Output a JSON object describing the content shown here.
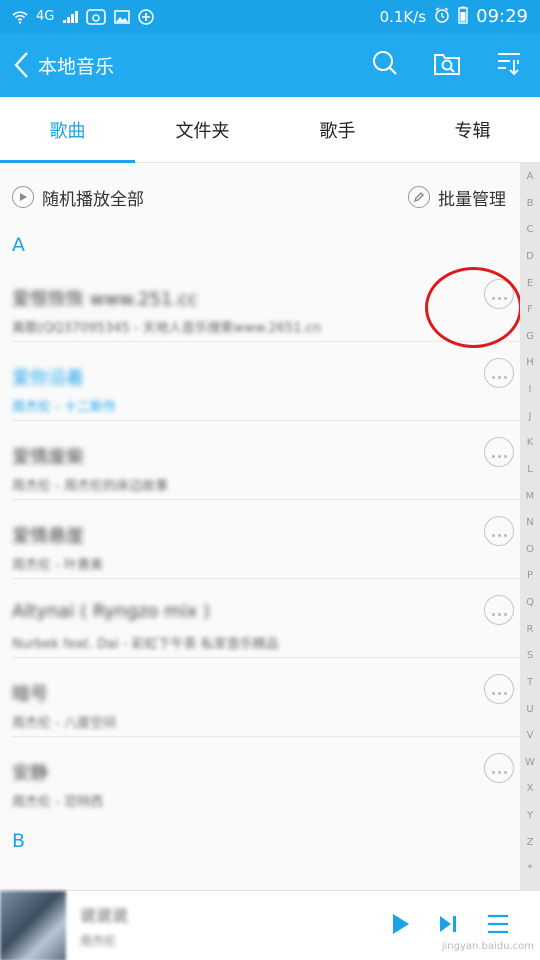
{
  "status": {
    "network_speed": "0.1K/s",
    "time": "09:29",
    "signal_label": "4G"
  },
  "appbar": {
    "title": "本地音乐"
  },
  "tabs": [
    {
      "label": "歌曲",
      "active": true
    },
    {
      "label": "文件夹",
      "active": false
    },
    {
      "label": "歌手",
      "active": false
    },
    {
      "label": "专辑",
      "active": false
    }
  ],
  "actions": {
    "shuffle_all": "随机播放全部",
    "batch_manage": "批量管理"
  },
  "sections": {
    "a": "A",
    "b": "B"
  },
  "songs": [
    {
      "title": "爱恨恢恢 www.251.cc",
      "subtitle": "离歌(QQ37095345 - 天地人音乐搜索www.2651.cn",
      "playing": false
    },
    {
      "title": "爱你沿着",
      "subtitle": "周杰伦 - 十二新作",
      "playing": true
    },
    {
      "title": "爱情废柴",
      "subtitle": "周杰伦 - 周杰伦的床边故事",
      "playing": false
    },
    {
      "title": "爱情悬崖",
      "subtitle": "周杰伦 - 叶惠美",
      "playing": false
    },
    {
      "title": "Altynai ( Ryngzo mix )",
      "subtitle": "Nurbek feat. Dai - 彩虹下午茶 私家音乐精品",
      "playing": false
    },
    {
      "title": "暗号",
      "subtitle": "周杰伦 - 八度空间",
      "playing": false
    },
    {
      "title": "安静",
      "subtitle": "周杰伦 - 范特西",
      "playing": false
    }
  ],
  "index_letters": [
    "A",
    "B",
    "C",
    "D",
    "E",
    "F",
    "G",
    "H",
    "I",
    "J",
    "K",
    "L",
    "M",
    "N",
    "O",
    "P",
    "Q",
    "R",
    "S",
    "T",
    "U",
    "V",
    "W",
    "X",
    "Y",
    "Z",
    "*"
  ],
  "player": {
    "title": "说说说",
    "subtitle": "周杰伦"
  },
  "watermark": "jingyan.baidu.com",
  "colors": {
    "accent": "#1aa3e8",
    "annotation": "#e01818"
  }
}
